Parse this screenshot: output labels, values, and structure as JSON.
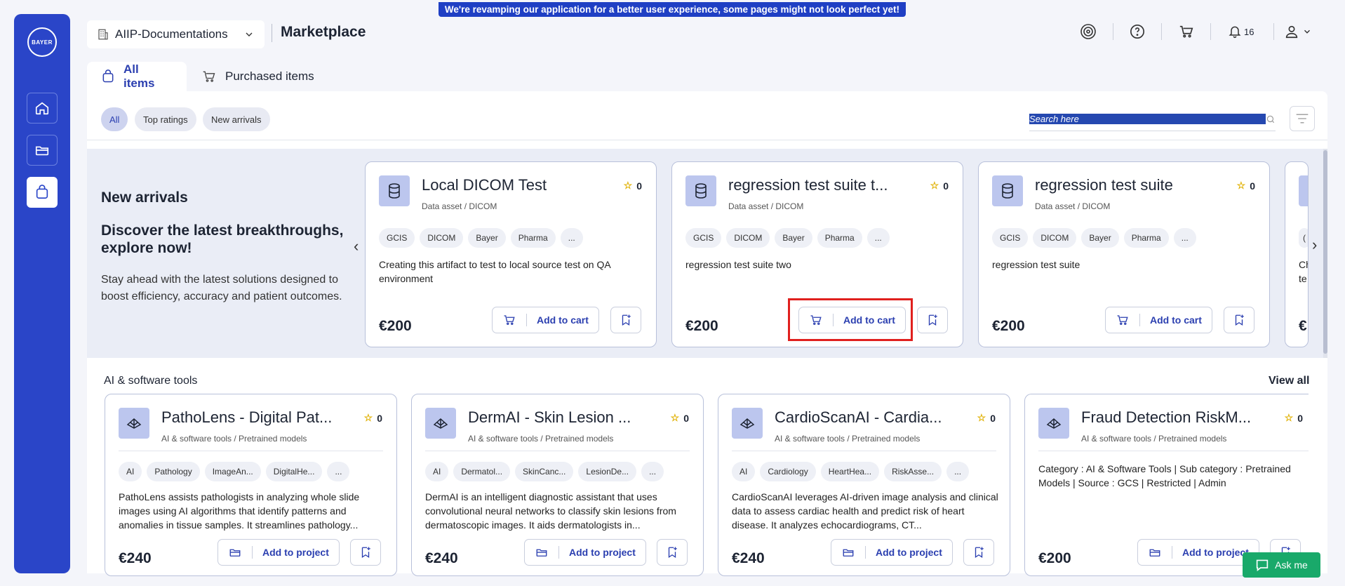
{
  "banner": "We're revamping our application for a better user experience, some pages might not look perfect yet!",
  "logo_text": "BAYER",
  "workspace": "AIIP-Documentations",
  "page_title": "Marketplace",
  "notifications_count": "16",
  "tabs": [
    {
      "label": "All items",
      "icon": "bag-icon"
    },
    {
      "label": "Purchased items",
      "icon": "cart-icon"
    }
  ],
  "chips": [
    "All",
    "Top ratings",
    "New arrivals"
  ],
  "search": {
    "placeholder": "Search here"
  },
  "new_arrivals": {
    "heading": "New arrivals",
    "tagline": "Discover the latest breakthroughs, explore now!",
    "description": "Stay ahead with the latest solutions designed to boost efficiency, accuracy and patient outcomes."
  },
  "arrival_cards": [
    {
      "title": "Local DICOM Test",
      "rating": "0",
      "subtitle": "Data asset / DICOM",
      "tags": [
        "GCIS",
        "DICOM",
        "Bayer",
        "Pharma",
        "..."
      ],
      "description": "Creating this artifact to test to local source test on QA environment",
      "price": "€200",
      "action": "Add to cart"
    },
    {
      "title": "regression test suite t...",
      "rating": "0",
      "subtitle": "Data asset / DICOM",
      "tags": [
        "GCIS",
        "DICOM",
        "Bayer",
        "Pharma",
        "..."
      ],
      "description": "regression test suite two",
      "price": "€200",
      "action": "Add to cart"
    },
    {
      "title": "regression test suite",
      "rating": "0",
      "subtitle": "Data asset / DICOM",
      "tags": [
        "GCIS",
        "DICOM",
        "Bayer",
        "Pharma",
        "..."
      ],
      "description": "regression test suite",
      "price": "€200",
      "action": "Add to cart"
    },
    {
      "title": "",
      "rating": "",
      "subtitle": "",
      "tags": [
        "(",
        ""
      ],
      "description": "Ch te",
      "price": "€",
      "action": ""
    }
  ],
  "ai_section": {
    "title": "AI & software tools",
    "view_all": "View all",
    "cards": [
      {
        "title": "PathoLens - Digital Pat...",
        "rating": "0",
        "subtitle": "AI & software tools / Pretrained models",
        "tags": [
          "AI",
          "Pathology",
          "ImageAn...",
          "DigitalHe...",
          "..."
        ],
        "description": "PathoLens assists pathologists in analyzing whole slide images using AI algorithms that identify patterns and anomalies in tissue samples. It streamlines pathology...",
        "price": "€240",
        "action": "Add to project"
      },
      {
        "title": "DermAI - Skin Lesion ...",
        "rating": "0",
        "subtitle": "AI & software tools / Pretrained models",
        "tags": [
          "AI",
          "Dermatol...",
          "SkinCanc...",
          "LesionDe...",
          "..."
        ],
        "description": "DermAI is an intelligent diagnostic assistant that uses convolutional neural networks to classify skin lesions from dermatoscopic images. It aids dermatologists in...",
        "price": "€240",
        "action": "Add to project"
      },
      {
        "title": "CardioScanAI - Cardia...",
        "rating": "0",
        "subtitle": "AI & software tools / Pretrained models",
        "tags": [
          "AI",
          "Cardiology",
          "HeartHea...",
          "RiskAsse...",
          "..."
        ],
        "description": "CardioScanAI leverages AI-driven image analysis and clinical data to assess cardiac health and predict risk of heart disease. It analyzes echocardiograms, CT...",
        "price": "€240",
        "action": "Add to project"
      },
      {
        "title": "Fraud Detection RiskM...",
        "rating": "0",
        "subtitle": "AI & software tools / Pretrained models",
        "tags": [],
        "description": "Category : AI & Software Tools | Sub category : Pretrained Models | Source : GCS | Restricted | Admin",
        "price": "€200",
        "action": "Add to project"
      }
    ]
  },
  "ask_me": "Ask me"
}
